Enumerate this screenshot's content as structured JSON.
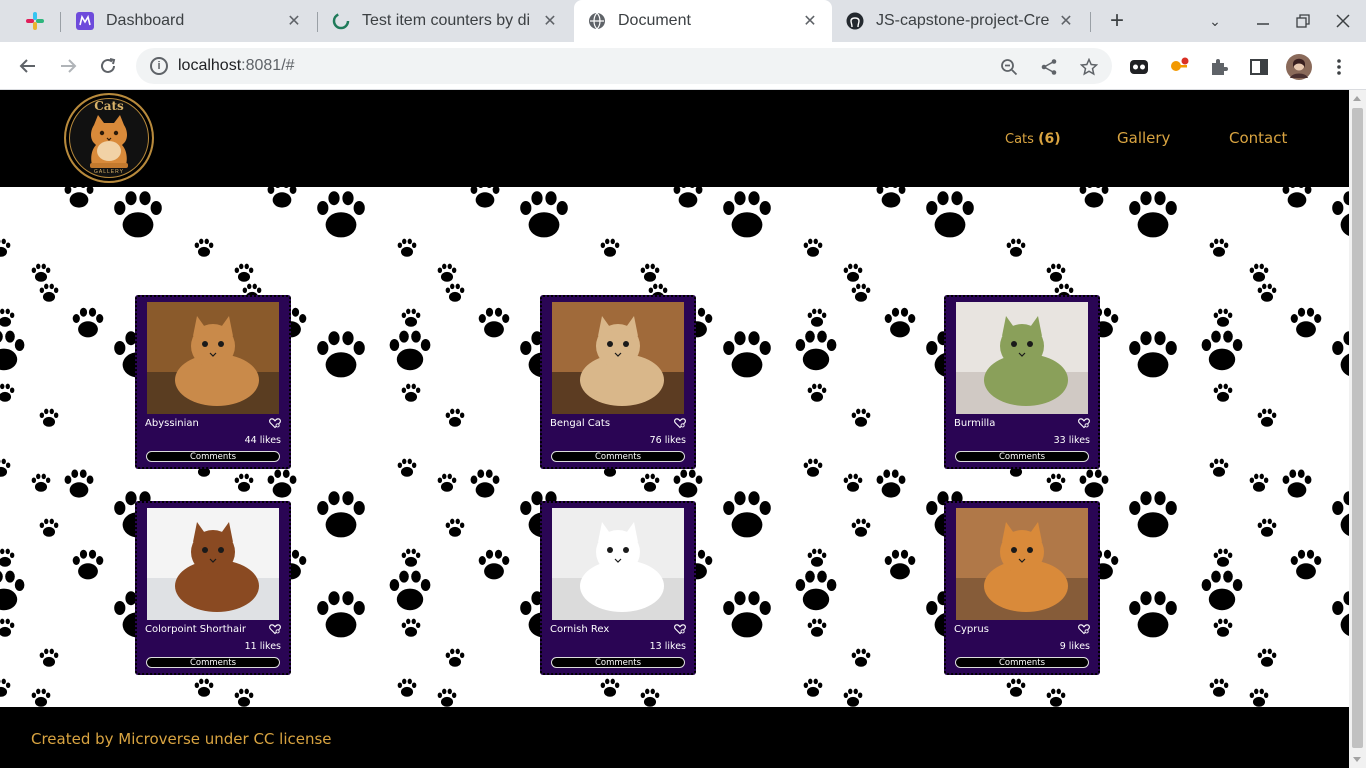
{
  "browser": {
    "tabs": [
      {
        "title": "Dashboard",
        "icon": "microverse-icon",
        "active": false
      },
      {
        "title": "Test item counters by di",
        "icon": "loading-icon",
        "active": false
      },
      {
        "title": "Document",
        "icon": "globe-icon",
        "active": true
      },
      {
        "title": "JS-capstone-project-Cre",
        "icon": "github-icon",
        "active": false
      }
    ],
    "new_tab_label": "+",
    "url_host": "localhost",
    "url_rest": ":8081/#"
  },
  "site": {
    "logo_top_text": "Cats",
    "logo_bottom_text": "GALLERY",
    "nav": {
      "cats_label": "Cats",
      "cats_count": "(6)",
      "gallery_label": "Gallery",
      "contact_label": "Contact"
    },
    "cards": [
      {
        "name": "Abyssinian",
        "likes": "44 likes",
        "comments": "Comments",
        "colors": [
          "#8a5a2b",
          "#c98a4a",
          "#3b2a1a"
        ]
      },
      {
        "name": "Bengal Cats",
        "likes": "76 likes",
        "comments": "Comments",
        "colors": [
          "#a06a3a",
          "#d9b78a",
          "#2e1e12"
        ]
      },
      {
        "name": "Burmilla",
        "likes": "33 likes",
        "comments": "Comments",
        "colors": [
          "#e8e4e0",
          "#8aa05a",
          "#c0b8b0"
        ]
      },
      {
        "name": "Colorpoint Shorthair",
        "likes": "11 likes",
        "comments": "Comments",
        "colors": [
          "#f4f4f4",
          "#8a4a22",
          "#d0d4d8"
        ]
      },
      {
        "name": "Cornish Rex",
        "likes": "13 likes",
        "comments": "Comments",
        "colors": [
          "#eeeeee",
          "#ffffff",
          "#cfcfcf"
        ]
      },
      {
        "name": "Cyprus",
        "likes": "9 likes",
        "comments": "Comments",
        "colors": [
          "#b07848",
          "#d98a3a",
          "#6a4a30"
        ]
      }
    ],
    "footer_text": "Created by Microverse under CC license"
  }
}
